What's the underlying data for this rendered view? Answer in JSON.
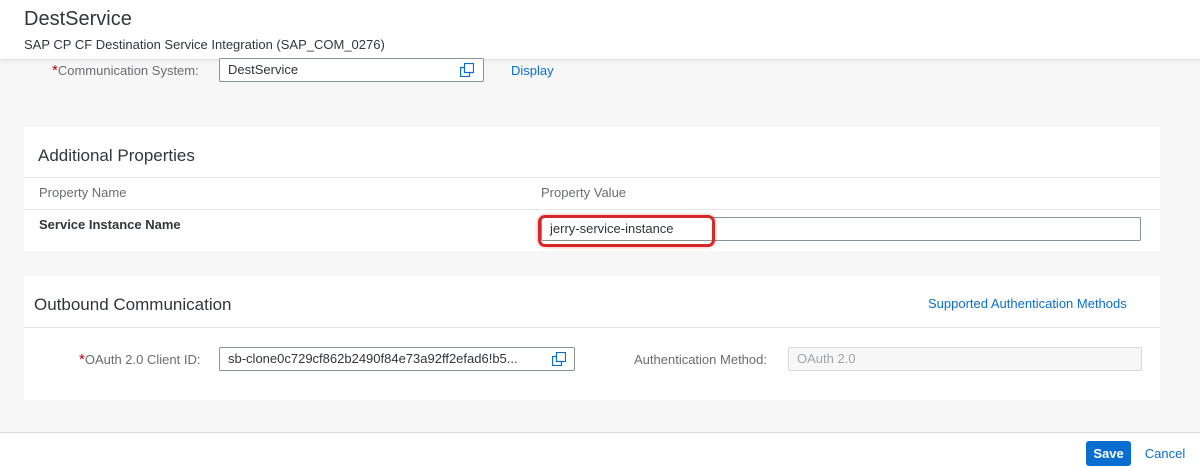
{
  "header": {
    "title": "DestService",
    "subtitle": "SAP CP CF Destination Service Integration (SAP_COM_0276)"
  },
  "communication_system": {
    "required_marker": "*",
    "label": "Communication System:",
    "value": "DestService",
    "display_link": "Display"
  },
  "additional_properties": {
    "title": "Additional Properties",
    "columns": [
      "Property Name",
      "Property Value"
    ],
    "rows": [
      {
        "name": "Service Instance Name",
        "value": "jerry-service-instance"
      }
    ]
  },
  "outbound": {
    "title": "Outbound Communication",
    "supported_link": "Supported Authentication Methods",
    "client_id": {
      "required_marker": "*",
      "label": "OAuth 2.0 Client ID:",
      "value": "sb-clone0c729cf862b2490f84e73a92ff2efad6!b5..."
    },
    "auth_method": {
      "label": "Authentication Method:",
      "value": "OAuth 2.0"
    }
  },
  "footer": {
    "save_label": "Save",
    "cancel_label": "Cancel"
  },
  "colors": {
    "accent": "#0a6ed1",
    "required": "#bb0000",
    "highlight": "#d62828"
  }
}
